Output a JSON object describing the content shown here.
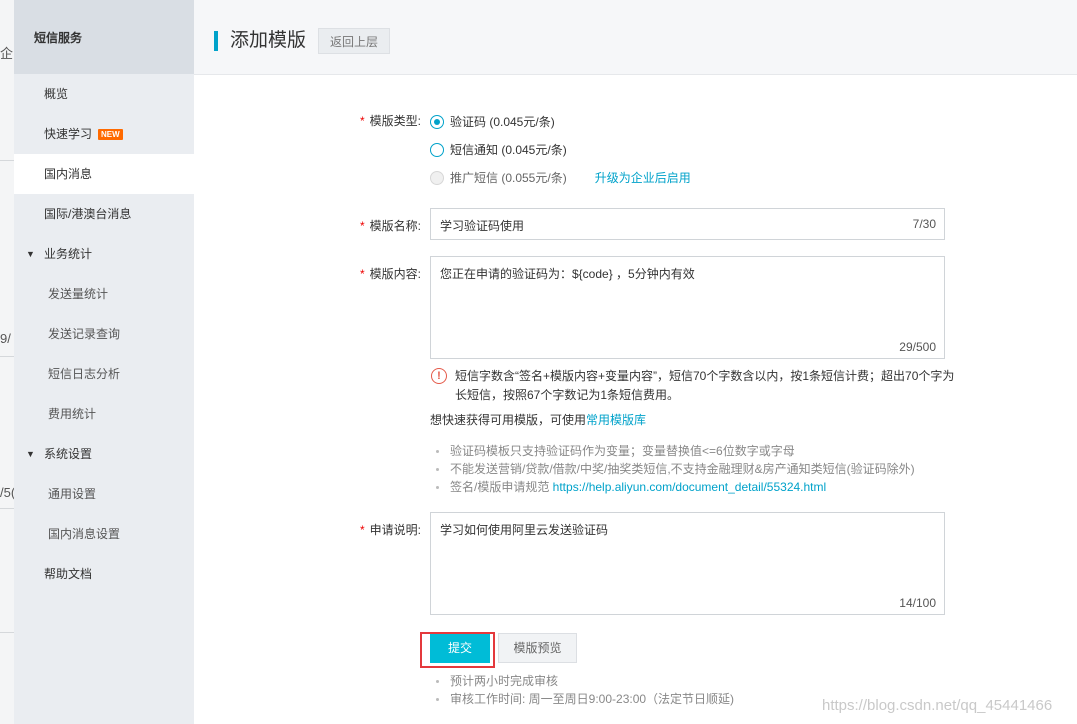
{
  "background_fragments": [
    "企",
    "9/",
    "/5("
  ],
  "sidebar": {
    "title": "短信服务",
    "items": [
      {
        "label": "概览",
        "kind": "item"
      },
      {
        "label": "快速学习",
        "kind": "item",
        "badge": "NEW"
      },
      {
        "label": "国内消息",
        "kind": "item",
        "active": true
      },
      {
        "label": "国际/港澳台消息",
        "kind": "item"
      },
      {
        "label": "业务统计",
        "kind": "group",
        "expanded": true
      },
      {
        "label": "发送量统计",
        "kind": "sub"
      },
      {
        "label": "发送记录查询",
        "kind": "sub"
      },
      {
        "label": "短信日志分析",
        "kind": "sub"
      },
      {
        "label": "费用统计",
        "kind": "sub"
      },
      {
        "label": "系统设置",
        "kind": "group",
        "expanded": true
      },
      {
        "label": "通用设置",
        "kind": "sub"
      },
      {
        "label": "国内消息设置",
        "kind": "sub"
      },
      {
        "label": "帮助文档",
        "kind": "item"
      }
    ]
  },
  "header": {
    "title": "添加模版",
    "back_label": "返回上层"
  },
  "form": {
    "template_type": {
      "label": "模版类型:",
      "options": [
        {
          "label": "验证码 (0.045元/条)",
          "checked": true,
          "disabled": false
        },
        {
          "label": "短信通知 (0.045元/条)",
          "checked": false,
          "disabled": false
        },
        {
          "label": "推广短信 (0.055元/条)",
          "checked": false,
          "disabled": true
        }
      ],
      "upgrade_link": "升级为企业后启用"
    },
    "template_name": {
      "label": "模版名称:",
      "value": "学习验证码使用",
      "counter": "7/30"
    },
    "template_content": {
      "label": "模版内容:",
      "value": "您正在申请的验证码为：${code} ，5分钟内有效",
      "counter": "29/500",
      "warning": "短信字数含“签名+模版内容+变量内容”，短信70个字数含以内，按1条短信计费；超出70个字为长短信，按照67个字数记为1条短信费用。",
      "quick_text": "想快速获得可用模版，可使用",
      "quick_link": "常用模版库",
      "tips": [
        {
          "text": "验证码模板只支持验证码作为变量；变量替换值<=6位数字或字母",
          "url": ""
        },
        {
          "text": "不能发送营销/贷款/借款/中奖/抽奖类短信,不支持金融理财&房产通知类短信(验证码除外)",
          "url": ""
        },
        {
          "text": "签名/模版申请规范 ",
          "url": "https://help.aliyun.com/document_detail/55324.html"
        }
      ]
    },
    "application_note": {
      "label": "申请说明:",
      "value": "学习如何使用阿里云发送验证码",
      "counter": "14/100"
    },
    "submit_label": "提交",
    "preview_label": "模版预览",
    "footer_tips": [
      "预计两小时完成审核",
      "审核工作时间: 周一至周日9:00-23:00（法定节日顺延)"
    ]
  },
  "watermark": "https://blog.csdn.net/qq_45441466",
  "colors": {
    "accent": "#00a2ca",
    "submit": "#00bcd7",
    "required_star": "#ee0000",
    "highlight_box": "#e4393c",
    "badge": "#ff6a00",
    "sidebar_bg": "#eaedf1"
  },
  "icons": {
    "warning": "exclamation-circle-icon",
    "group_toggle": "caret-down-icon"
  }
}
